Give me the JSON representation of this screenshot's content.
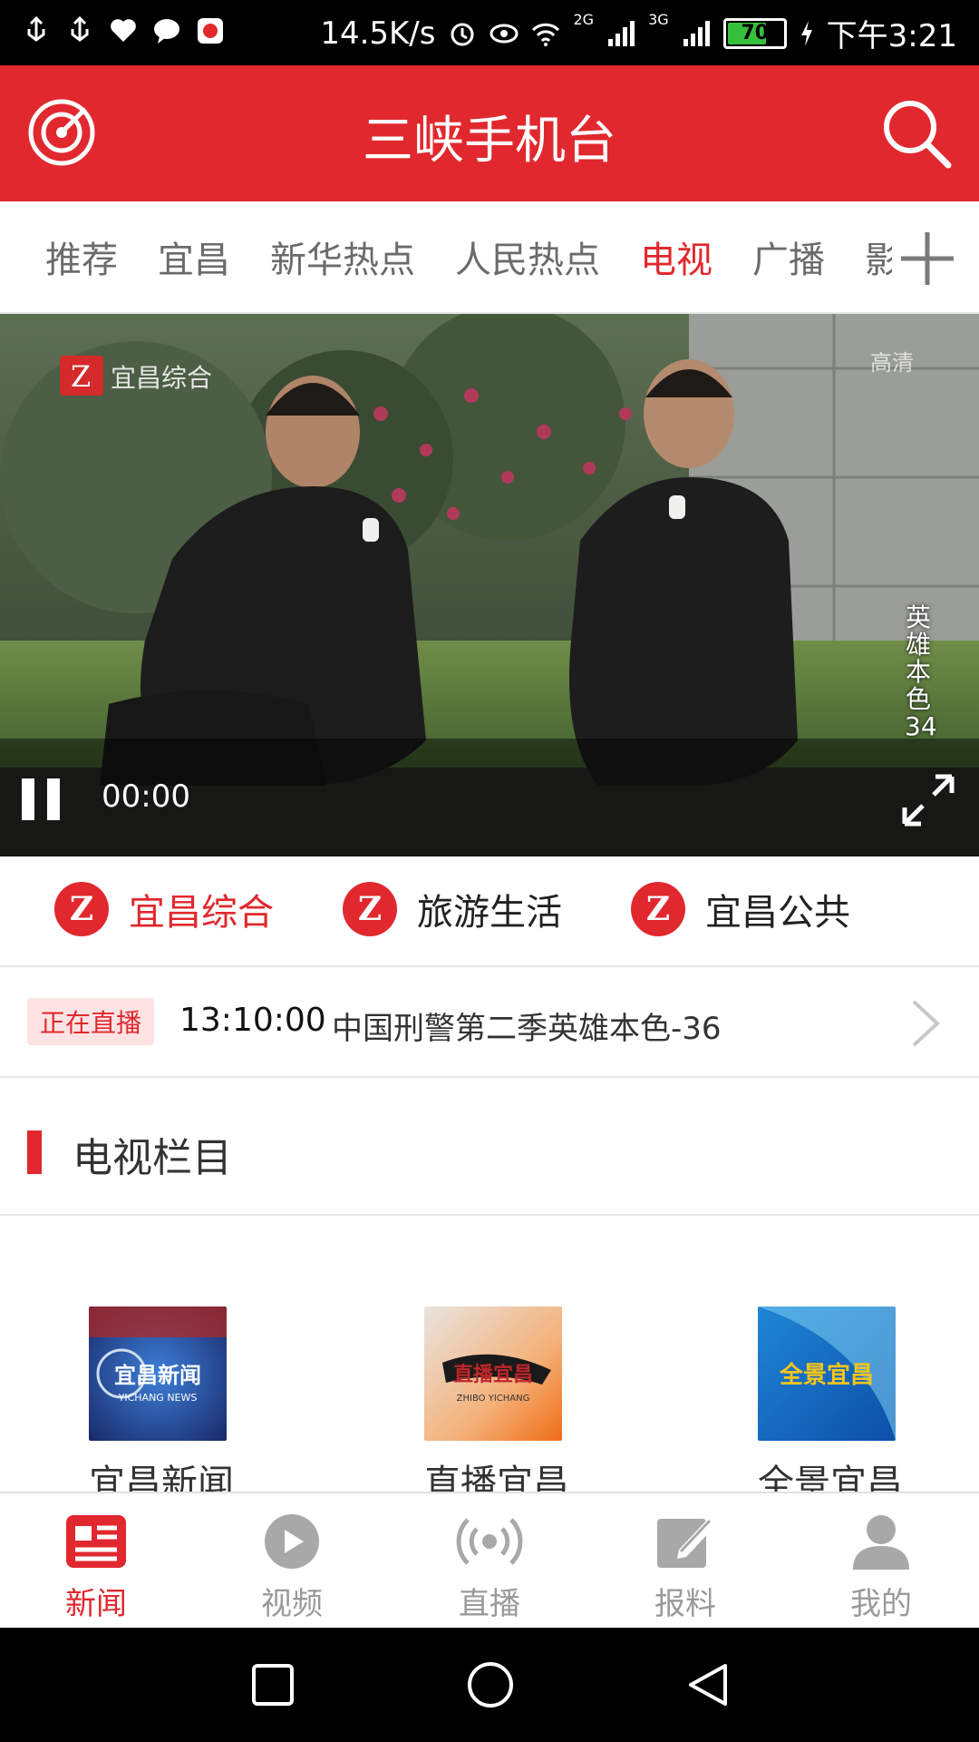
{
  "status": {
    "net_speed": "14.5K/s",
    "signal_2g": "2G",
    "signal_3g": "3G",
    "battery": "70",
    "time": "下午3:21"
  },
  "header": {
    "title": "三峡手机台",
    "left_icon": "radar-icon",
    "right_icon": "search-icon"
  },
  "tabs": {
    "items": [
      "推荐",
      "宜昌",
      "新华热点",
      "人民热点",
      "电视",
      "广播",
      "影"
    ],
    "active_index": 4,
    "add_icon": "plus-icon"
  },
  "video": {
    "overlay_channel": "宜昌综合",
    "watermark": "高清",
    "vertical_title": "英雄本色34",
    "time": "00:00"
  },
  "channels": [
    {
      "label": "宜昌综合",
      "active": true
    },
    {
      "label": "旅游生活",
      "active": false
    },
    {
      "label": "宜昌公共",
      "active": false
    }
  ],
  "live": {
    "badge": "正在直播",
    "time": "13:10:00",
    "title": "中国刑警第二季英雄本色-36"
  },
  "section": {
    "title": "电视栏目"
  },
  "programs": [
    {
      "label": "宜昌新闻",
      "thumb_text": "宜昌新闻",
      "thumb_sub": "YICHANG NEWS"
    },
    {
      "label": "直播宜昌",
      "thumb_text": "直播宜昌",
      "thumb_sub": "ZHIBO YICHANG"
    },
    {
      "label": "全景宜昌",
      "thumb_text": "全景宜昌",
      "thumb_sub": ""
    }
  ],
  "bottom_nav": [
    {
      "label": "新闻",
      "icon": "news-icon",
      "active": true
    },
    {
      "label": "视频",
      "icon": "play-icon",
      "active": false
    },
    {
      "label": "直播",
      "icon": "broadcast-icon",
      "active": false
    },
    {
      "label": "报料",
      "icon": "edit-icon",
      "active": false
    },
    {
      "label": "我的",
      "icon": "user-icon",
      "active": false
    }
  ],
  "colors": {
    "brand": "#e1282e",
    "inactive": "#9a9a9a"
  }
}
